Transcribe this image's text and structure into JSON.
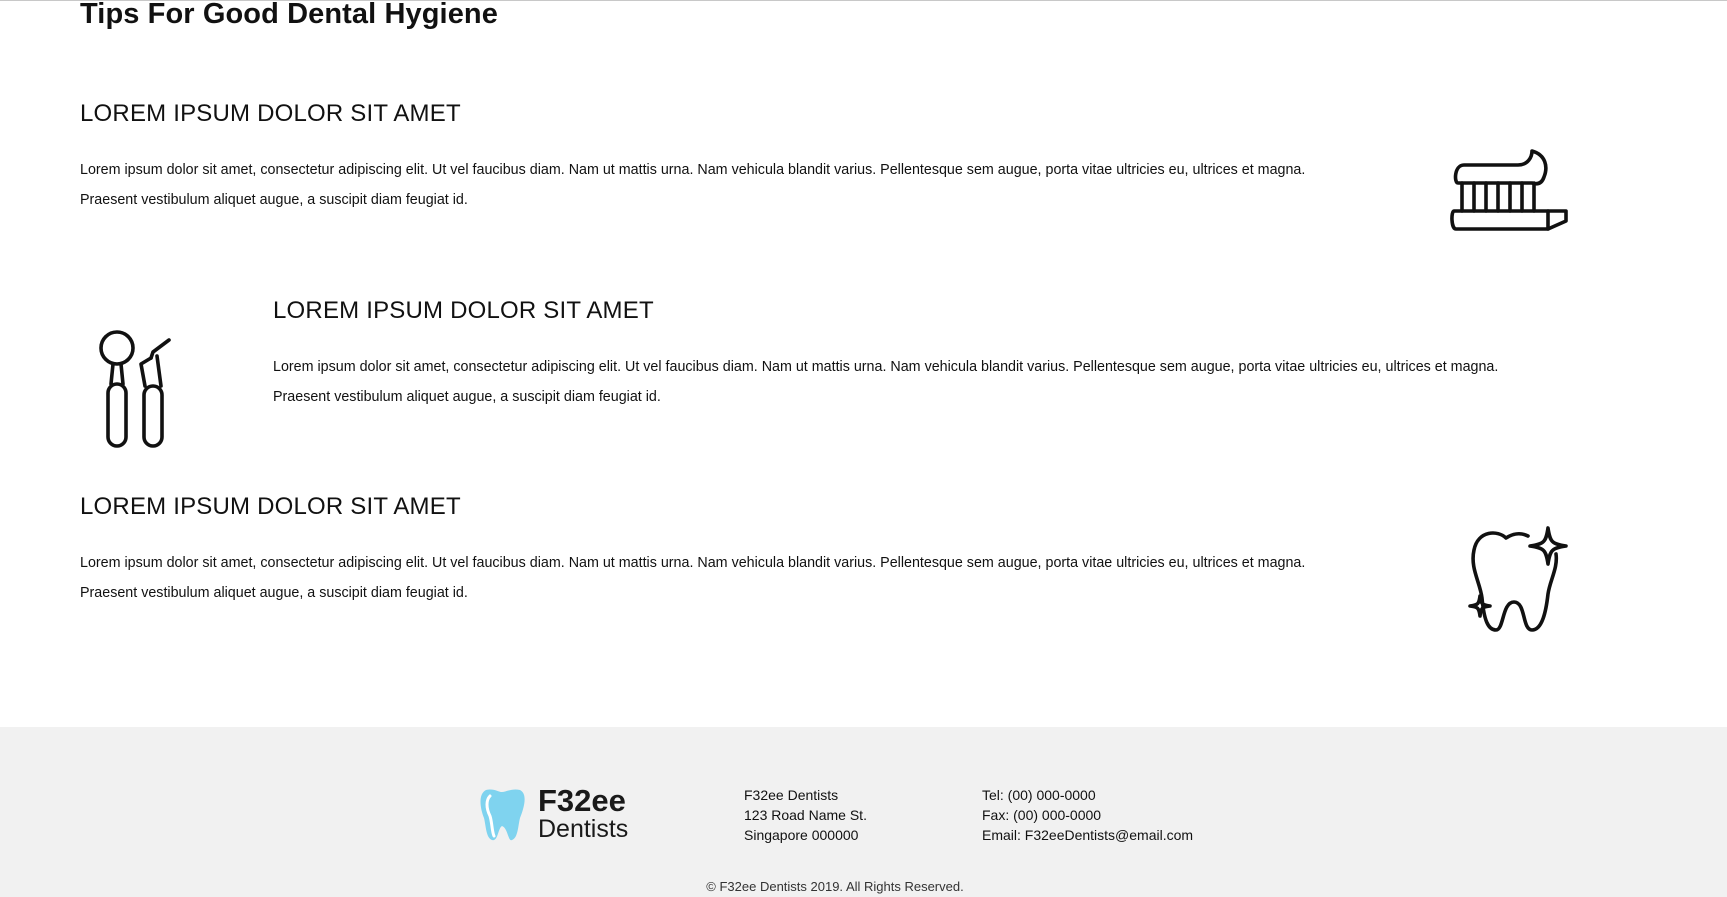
{
  "page": {
    "title": "Tips For Good Dental Hygiene"
  },
  "tips": [
    {
      "heading": "LOREM IPSUM DOLOR SIT AMET",
      "line1": "Lorem ipsum dolor sit amet, consectetur adipiscing elit. Ut vel faucibus diam. Nam ut mattis urna. Nam vehicula blandit varius. Pellentesque sem augue, porta vitae ultricies eu, ultrices et magna.",
      "line2": "Praesent vestibulum aliquet augue, a suscipit diam feugiat id.",
      "icon": "toothbrush-icon"
    },
    {
      "heading": "LOREM IPSUM DOLOR SIT AMET",
      "line1": "Lorem ipsum dolor sit amet, consectetur adipiscing elit. Ut vel faucibus diam. Nam ut mattis urna. Nam vehicula blandit varius. Pellentesque sem augue, porta vitae ultricies eu, ultrices et magna.",
      "line2": "Praesent vestibulum aliquet augue, a suscipit diam feugiat id.",
      "icon": "dental-tools-icon"
    },
    {
      "heading": "LOREM IPSUM DOLOR SIT AMET",
      "line1": "Lorem ipsum dolor sit amet, consectetur adipiscing elit. Ut vel faucibus diam. Nam ut mattis urna. Nam vehicula blandit varius. Pellentesque sem augue, porta vitae ultricies eu, ultrices et magna.",
      "line2": "Praesent vestibulum aliquet augue, a suscipit diam feugiat id.",
      "icon": "sparkling-tooth-icon"
    }
  ],
  "footer": {
    "brand": {
      "name": "F32ee",
      "subtitle": "Dentists",
      "accent": "#7fd3ef"
    },
    "address": {
      "line1": "F32ee Dentists",
      "line2": "123 Road Name St.",
      "line3": "Singapore 000000"
    },
    "contact": {
      "tel": "Tel: (00) 000-0000",
      "fax": "Fax: (00) 000-0000",
      "email": "Email: F32eeDentists@email.com"
    },
    "copyright": "© F32ee Dentists 2019. All Rights Reserved."
  },
  "colors": {
    "footer_background": "#f1f1f1",
    "text": "#111111"
  }
}
